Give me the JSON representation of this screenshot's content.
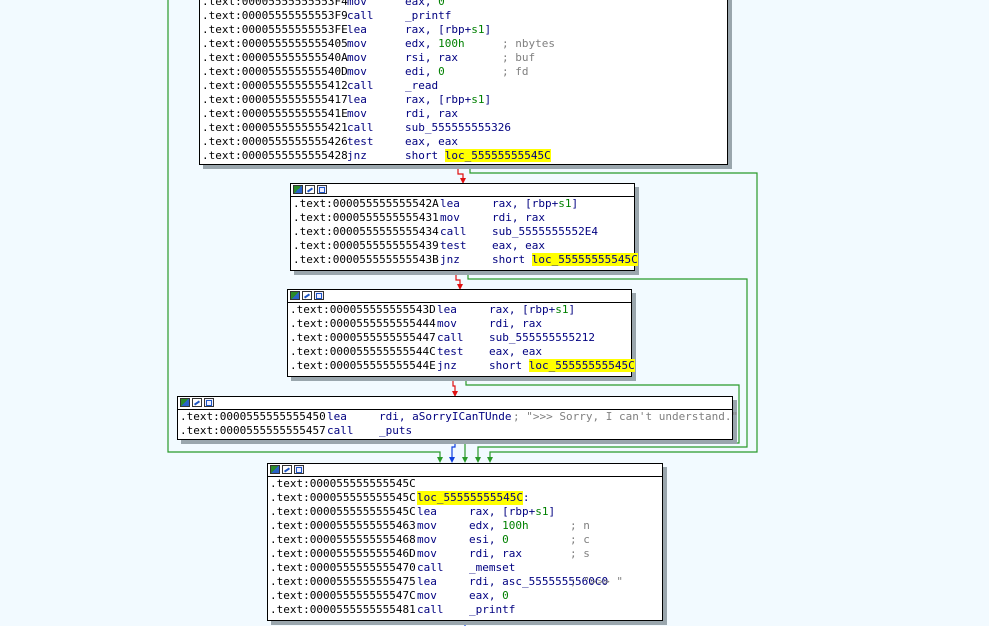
{
  "blocks": [
    {
      "id": "b0",
      "header": false,
      "lines": [
        {
          "addr": ".text:00005555555553F4",
          "mn": "mov",
          "ops": [
            {
              "t": "eax, "
            },
            {
              "t": "0",
              "k": "num"
            }
          ]
        },
        {
          "addr": ".text:00005555555553F9",
          "mn": "call",
          "ops": [
            {
              "t": "_printf"
            }
          ]
        },
        {
          "addr": ".text:00005555555553FE",
          "mn": "lea",
          "ops": [
            {
              "t": "rax, [rbp+"
            },
            {
              "t": "s1",
              "k": "num"
            },
            {
              "t": "]"
            }
          ]
        },
        {
          "addr": ".text:0000555555555405",
          "mn": "mov",
          "ops": [
            {
              "t": "edx, "
            },
            {
              "t": "100h",
              "k": "num"
            }
          ],
          "cmt": "; nbytes"
        },
        {
          "addr": ".text:000055555555540A",
          "mn": "mov",
          "ops": [
            {
              "t": "rsi, rax"
            }
          ],
          "cmt": "; buf"
        },
        {
          "addr": ".text:000055555555540D",
          "mn": "mov",
          "ops": [
            {
              "t": "edi, "
            },
            {
              "t": "0",
              "k": "num"
            }
          ],
          "cmt": "; fd"
        },
        {
          "addr": ".text:0000555555555412",
          "mn": "call",
          "ops": [
            {
              "t": "_read"
            }
          ]
        },
        {
          "addr": ".text:0000555555555417",
          "mn": "lea",
          "ops": [
            {
              "t": "rax, [rbp+"
            },
            {
              "t": "s1",
              "k": "num"
            },
            {
              "t": "]"
            }
          ]
        },
        {
          "addr": ".text:000055555555541E",
          "mn": "mov",
          "ops": [
            {
              "t": "rdi, rax"
            }
          ]
        },
        {
          "addr": ".text:0000555555555421",
          "mn": "call",
          "ops": [
            {
              "t": "sub_555555555326"
            }
          ]
        },
        {
          "addr": ".text:0000555555555426",
          "mn": "test",
          "ops": [
            {
              "t": "eax, eax"
            }
          ]
        },
        {
          "addr": ".text:0000555555555428",
          "mn": "jnz",
          "ops": [
            {
              "t": "short "
            },
            {
              "t": "loc_55555555545C",
              "k": "hl"
            }
          ]
        }
      ]
    },
    {
      "id": "b1",
      "header": true,
      "lines": [
        {
          "addr": ".text:000055555555542A",
          "mn": "lea",
          "ops": [
            {
              "t": "rax, [rbp+"
            },
            {
              "t": "s1",
              "k": "num"
            },
            {
              "t": "]"
            }
          ]
        },
        {
          "addr": ".text:0000555555555431",
          "mn": "mov",
          "ops": [
            {
              "t": "rdi, rax"
            }
          ]
        },
        {
          "addr": ".text:0000555555555434",
          "mn": "call",
          "ops": [
            {
              "t": "sub_5555555552E4"
            }
          ]
        },
        {
          "addr": ".text:0000555555555439",
          "mn": "test",
          "ops": [
            {
              "t": "eax, eax"
            }
          ]
        },
        {
          "addr": ".text:000055555555543B",
          "mn": "jnz",
          "ops": [
            {
              "t": "short "
            },
            {
              "t": "loc_55555555545C",
              "k": "hl"
            }
          ]
        }
      ]
    },
    {
      "id": "b2",
      "header": true,
      "lines": [
        {
          "addr": ".text:000055555555543D",
          "mn": "lea",
          "ops": [
            {
              "t": "rax, [rbp+"
            },
            {
              "t": "s1",
              "k": "num"
            },
            {
              "t": "]"
            }
          ]
        },
        {
          "addr": ".text:0000555555555444",
          "mn": "mov",
          "ops": [
            {
              "t": "rdi, rax"
            }
          ]
        },
        {
          "addr": ".text:0000555555555447",
          "mn": "call",
          "ops": [
            {
              "t": "sub_555555555212"
            }
          ]
        },
        {
          "addr": ".text:000055555555544C",
          "mn": "test",
          "ops": [
            {
              "t": "eax, eax"
            }
          ]
        },
        {
          "addr": ".text:000055555555544E",
          "mn": "jnz",
          "ops": [
            {
              "t": "short "
            },
            {
              "t": "loc_55555555545C",
              "k": "hl"
            }
          ]
        }
      ]
    },
    {
      "id": "b3",
      "header": true,
      "lines": [
        {
          "addr": ".text:0000555555555450",
          "mn": "lea",
          "ops": [
            {
              "t": "rdi, aSorryICanTUnde"
            }
          ],
          "cmt": "; \">>> Sorry, I can't understand.\""
        },
        {
          "addr": ".text:0000555555555457",
          "mn": "call",
          "ops": [
            {
              "t": "_puts"
            }
          ]
        }
      ]
    },
    {
      "id": "b4",
      "header": true,
      "lines": [
        {
          "addr": ".text:000055555555545C",
          "mn": "",
          "ops": []
        },
        {
          "addr": ".text:000055555555545C",
          "label": "loc_55555555545C",
          "labelSuffix": ":"
        },
        {
          "addr": ".text:000055555555545C",
          "mn": "lea",
          "ops": [
            {
              "t": "rax, [rbp+"
            },
            {
              "t": "s1",
              "k": "num"
            },
            {
              "t": "]"
            }
          ]
        },
        {
          "addr": ".text:0000555555555463",
          "mn": "mov",
          "ops": [
            {
              "t": "edx, "
            },
            {
              "t": "100h",
              "k": "num"
            }
          ],
          "cmt": "; n"
        },
        {
          "addr": ".text:0000555555555468",
          "mn": "mov",
          "ops": [
            {
              "t": "esi, "
            },
            {
              "t": "0",
              "k": "num"
            }
          ],
          "cmt": "; c"
        },
        {
          "addr": ".text:000055555555546D",
          "mn": "mov",
          "ops": [
            {
              "t": "rdi, rax"
            }
          ],
          "cmt": "; s"
        },
        {
          "addr": ".text:0000555555555470",
          "mn": "call",
          "ops": [
            {
              "t": "_memset"
            }
          ]
        },
        {
          "addr": ".text:0000555555555475",
          "mn": "lea",
          "ops": [
            {
              "t": "rdi, asc_5555555560C0"
            }
          ],
          "cmt": "; \">>> \""
        },
        {
          "addr": ".text:000055555555547C",
          "mn": "mov",
          "ops": [
            {
              "t": "eax, "
            },
            {
              "t": "0",
              "k": "num"
            }
          ]
        },
        {
          "addr": ".text:0000555555555481",
          "mn": "call",
          "ops": [
            {
              "t": "_printf"
            }
          ]
        }
      ]
    }
  ],
  "colors": {
    "background": "#f2faff",
    "edge_taken": "#008000",
    "edge_fallthrough": "#ff0000",
    "edge_unconditional": "#0000ff",
    "highlight": "#ffff00"
  }
}
